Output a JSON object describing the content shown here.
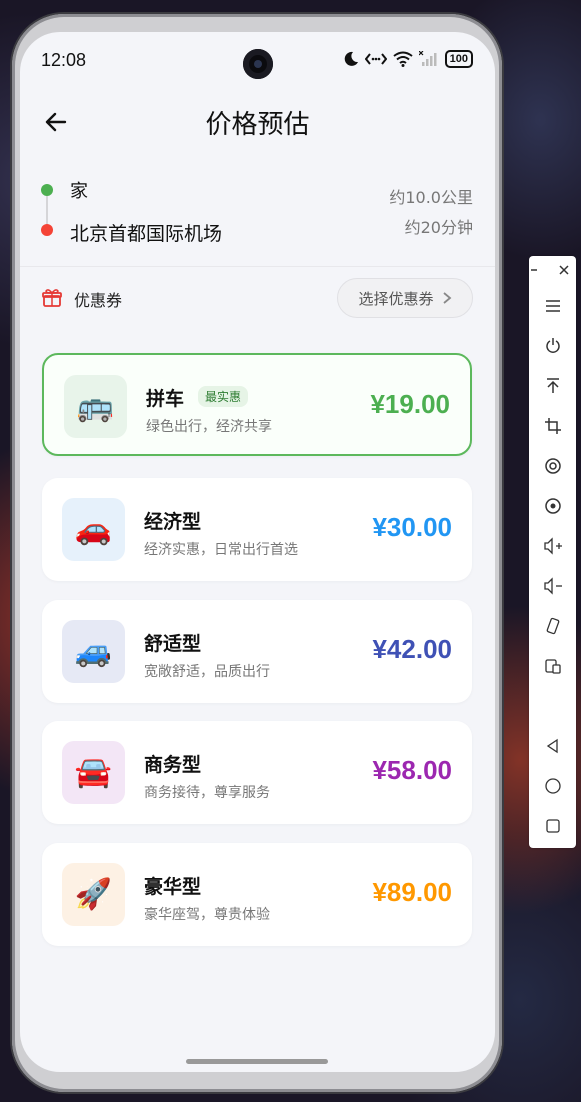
{
  "status_bar": {
    "time": "12:08",
    "battery": "100",
    "icons": [
      "moon-icon",
      "data-transfer-icon",
      "wifi-icon",
      "signal-icon",
      "battery-icon"
    ]
  },
  "header": {
    "title": "价格预估",
    "back_icon": "arrow-left-icon"
  },
  "route": {
    "origin": "家",
    "destination": "北京首都国际机场",
    "distance": "约10.0公里",
    "duration": "约20分钟",
    "origin_color": "#4caf50",
    "destination_color": "#f44336"
  },
  "coupon": {
    "label": "优惠券",
    "button_label": "选择优惠券",
    "icon": "gift-icon"
  },
  "rides": [
    {
      "name": "拼车",
      "badge": "最实惠",
      "desc": "绿色出行，经济共享",
      "price": "¥19.00",
      "icon": "🚌",
      "icon_name": "bus-icon",
      "color": "#4caf50",
      "bg": "#e8f4ea",
      "selected": true
    },
    {
      "name": "经济型",
      "desc": "经济实惠，日常出行首选",
      "price": "¥30.00",
      "icon": "🚗",
      "icon_name": "car-icon",
      "color": "#2196f3",
      "bg": "#e6f1fb",
      "selected": false
    },
    {
      "name": "舒适型",
      "desc": "宽敞舒适，品质出行",
      "price": "¥42.00",
      "icon": "🚙",
      "icon_name": "suv-icon",
      "color": "#3f51b5",
      "bg": "#e6e9f5",
      "selected": false
    },
    {
      "name": "商务型",
      "desc": "商务接待，尊享服务",
      "price": "¥58.00",
      "icon": "🚘",
      "icon_name": "sedan-icon",
      "color": "#9c27b0",
      "bg": "#f3e6f6",
      "selected": false
    },
    {
      "name": "豪华型",
      "desc": "豪华座驾，尊贵体验",
      "price": "¥89.00",
      "icon": "🚀",
      "icon_name": "rocket-icon",
      "color": "#ff9800",
      "bg": "#fdf1e4",
      "selected": false
    }
  ],
  "side_toolbar": {
    "items": [
      "minimize-icon",
      "close-icon",
      "menu-icon",
      "power-icon",
      "pin-top-icon",
      "crop-icon",
      "record-icon",
      "screenshot-icon",
      "volume-up-icon",
      "volume-down-icon",
      "rotate-icon",
      "multi-window-icon",
      "back-icon",
      "home-icon",
      "recents-icon"
    ]
  }
}
